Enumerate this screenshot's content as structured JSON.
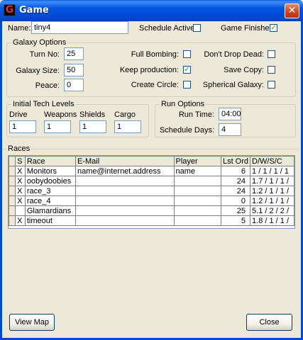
{
  "window": {
    "title": "Game",
    "logo_letter": "G",
    "close_glyph": "✕"
  },
  "general": {
    "name_label": "Name:",
    "name_value": "tiny4",
    "schedule_active_label": "Schedule Active:",
    "schedule_active": false,
    "game_finished_label": "Game Finished:",
    "game_finished": true
  },
  "galaxy_options": {
    "title": "Galaxy Options",
    "turn_no_label": "Turn No:",
    "turn_no": "25",
    "galaxy_size_label": "Galaxy Size:",
    "galaxy_size": "50",
    "peace_label": "Peace:",
    "peace": "0",
    "full_bombing_label": "Full Bombing:",
    "full_bombing": false,
    "keep_production_label": "Keep production:",
    "keep_production": true,
    "create_circle_label": "Create Circle:",
    "create_circle": false,
    "dont_drop_dead_label": "Don't Drop Dead:",
    "dont_drop_dead": false,
    "save_copy_label": "Save Copy:",
    "save_copy": false,
    "spherical_galaxy_label": "Spherical Galaxy:",
    "spherical_galaxy": false
  },
  "tech_levels": {
    "title": "Initial Tech Levels",
    "drive_label": "Drive",
    "drive": "1",
    "weapons_label": "Weapons",
    "weapons": "1",
    "shields_label": "Shields",
    "shields": "1",
    "cargo_label": "Cargo",
    "cargo": "1"
  },
  "run_options": {
    "title": "Run Options",
    "run_time_label": "Run Time:",
    "run_time": "04:00",
    "schedule_days_label": "Schedule Days:",
    "schedule_days": "4"
  },
  "races": {
    "title": "Races",
    "columns": [
      "",
      "S",
      "Race",
      "E-Mail",
      "Player",
      "Lst Ord",
      "D/W/S/C"
    ],
    "rows": [
      {
        "s": "X",
        "race": "Monitors",
        "email": "name@internet.address",
        "player": "name",
        "lst_ord": "6",
        "dwsc": "1 / 1 / 1 / 1"
      },
      {
        "s": "X",
        "race": "oobydoobies",
        "email": "",
        "player": "",
        "lst_ord": "24",
        "dwsc": "1.7 / 1 / 1 /"
      },
      {
        "s": "X",
        "race": "race_3",
        "email": "",
        "player": "",
        "lst_ord": "24",
        "dwsc": "1.2 / 1 / 1 /"
      },
      {
        "s": "X",
        "race": "race_4",
        "email": "",
        "player": "",
        "lst_ord": "0",
        "dwsc": "1.2 / 1 / 1 /"
      },
      {
        "s": "",
        "race": "Glamardians",
        "email": "",
        "player": "",
        "lst_ord": "25",
        "dwsc": "5.1 / 2 / 2 /"
      },
      {
        "s": "X",
        "race": "timeout",
        "email": "",
        "player": "",
        "lst_ord": "5",
        "dwsc": "1.8 / 1 / 1 /"
      }
    ]
  },
  "buttons": {
    "view_map": "View Map",
    "close": "Close"
  }
}
